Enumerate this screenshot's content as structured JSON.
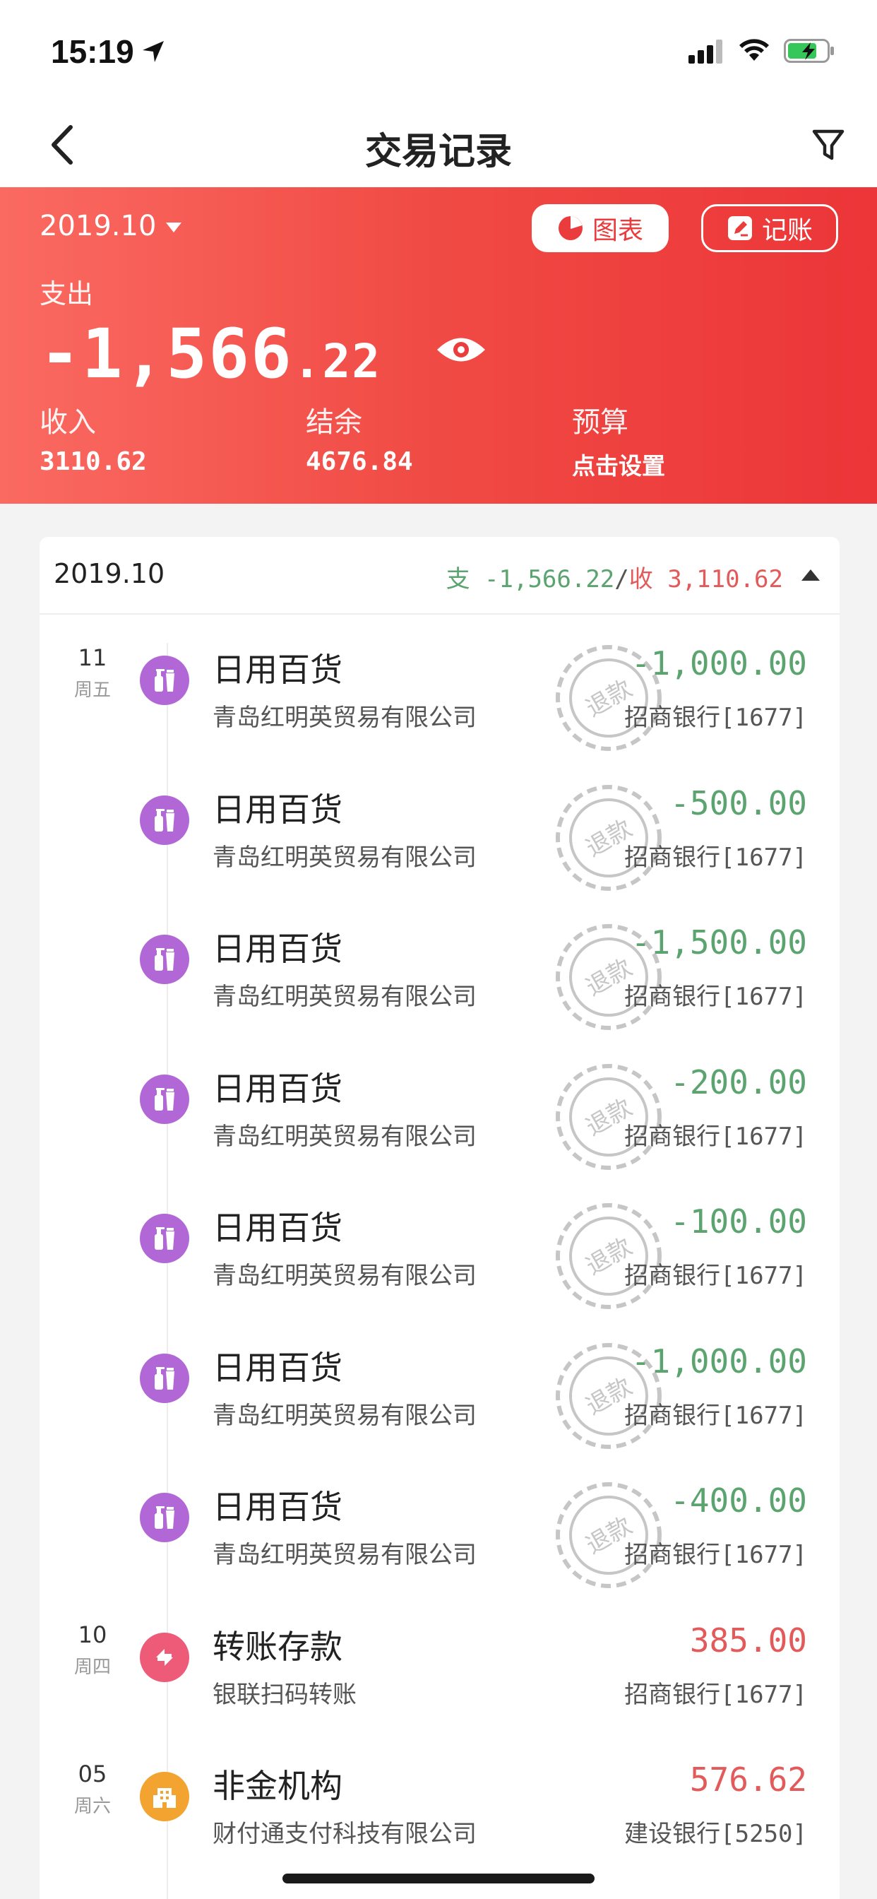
{
  "status_bar": {
    "time": "15:19"
  },
  "nav": {
    "title": "交易记录"
  },
  "header": {
    "month": "2019.10",
    "chart_label": "图表",
    "record_label": "记账",
    "expense_label": "支出",
    "expense_int": "-1,566",
    "expense_dec": ".22",
    "income_label": "收入",
    "income_value": "3110.62",
    "balance_label": "结余",
    "balance_value": "4676.84",
    "budget_label": "预算",
    "budget_value": "点击设置"
  },
  "card": {
    "month": "2019.10",
    "expense_prefix": "支",
    "expense_total": " -1,566.22",
    "sep": "/",
    "income_prefix": "收",
    "income_total": " 3,110.62"
  },
  "stamp_text": "退款",
  "transactions": [
    {
      "day": "11",
      "weekday": "周五",
      "category": "日用百货",
      "merchant": "青岛红明英贸易有限公司",
      "amount": "-1,000.00",
      "account": "招商银行[1677]",
      "icon": "daily-goods-icon",
      "refund": true
    },
    {
      "day": "",
      "weekday": "",
      "category": "日用百货",
      "merchant": "青岛红明英贸易有限公司",
      "amount": "-500.00",
      "account": "招商银行[1677]",
      "icon": "daily-goods-icon",
      "refund": true
    },
    {
      "day": "",
      "weekday": "",
      "category": "日用百货",
      "merchant": "青岛红明英贸易有限公司",
      "amount": "-1,500.00",
      "account": "招商银行[1677]",
      "icon": "daily-goods-icon",
      "refund": true
    },
    {
      "day": "",
      "weekday": "",
      "category": "日用百货",
      "merchant": "青岛红明英贸易有限公司",
      "amount": "-200.00",
      "account": "招商银行[1677]",
      "icon": "daily-goods-icon",
      "refund": true
    },
    {
      "day": "",
      "weekday": "",
      "category": "日用百货",
      "merchant": "青岛红明英贸易有限公司",
      "amount": "-100.00",
      "account": "招商银行[1677]",
      "icon": "daily-goods-icon",
      "refund": true
    },
    {
      "day": "",
      "weekday": "",
      "category": "日用百货",
      "merchant": "青岛红明英贸易有限公司",
      "amount": "-1,000.00",
      "account": "招商银行[1677]",
      "icon": "daily-goods-icon",
      "refund": true
    },
    {
      "day": "",
      "weekday": "",
      "category": "日用百货",
      "merchant": "青岛红明英贸易有限公司",
      "amount": "-400.00",
      "account": "招商银行[1677]",
      "icon": "daily-goods-icon",
      "refund": true
    },
    {
      "day": "10",
      "weekday": "周四",
      "category": "转账存款",
      "merchant": "银联扫码转账",
      "amount": "385.00",
      "account": "招商银行[1677]",
      "icon": "transfer-icon",
      "refund": false
    },
    {
      "day": "05",
      "weekday": "周六",
      "category": "非金机构",
      "merchant": "财付通支付科技有限公司",
      "amount": "576.62",
      "account": "建设银行[5250]",
      "icon": "institution-icon",
      "refund": false
    }
  ],
  "colors": {
    "accent": "#ec3538",
    "expense": "#5ca46f",
    "income": "#e35a5a",
    "daily_icon": "#b267d6",
    "transfer_icon": "#ee5b79",
    "institution_icon": "#f2a330"
  }
}
